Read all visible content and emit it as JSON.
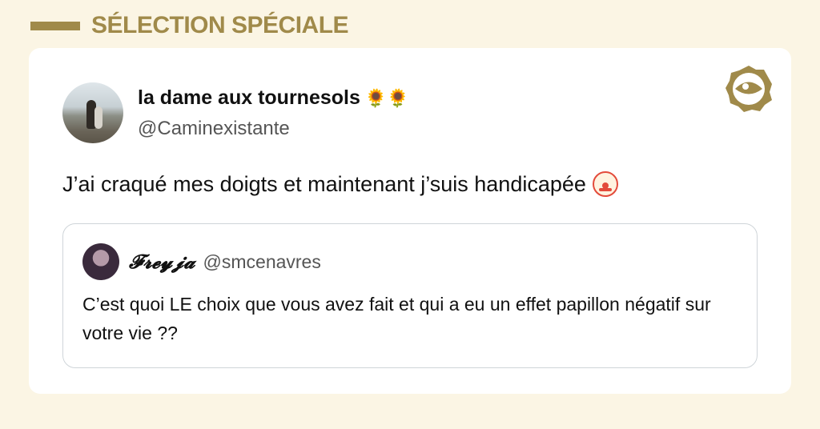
{
  "header": {
    "title": "SÉLECTION SPÉCIALE"
  },
  "tweet": {
    "author": {
      "name": "la dame aux tournesols",
      "handle": "@Caminexistante",
      "name_emoji": "🌻🌻"
    },
    "text": "J’ai craqué mes doigts et maintenant j’suis handicapée",
    "emoji": "clown-face-icon",
    "quoted": {
      "name": "𝓕𝓻𝓮𝔂𝓳𝓪",
      "handle": "@smcenavres",
      "text": "C’est quoi LE choix que vous avez fait et qui a eu un effet papillon négatif sur votre vie ??"
    }
  },
  "colors": {
    "background": "#fbf5e4",
    "accent": "#a08a4a",
    "card": "#ffffff",
    "quote_border": "#cfd5d9"
  }
}
